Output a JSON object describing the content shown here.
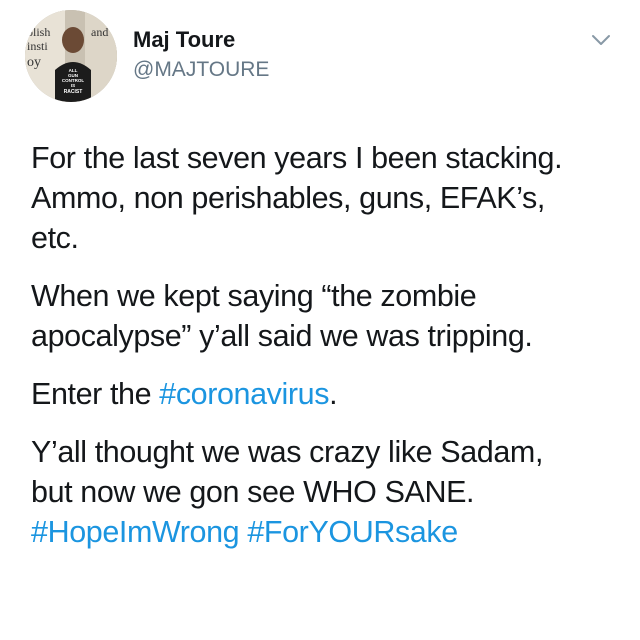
{
  "author": {
    "display_name": "Maj Toure",
    "handle": "@MAJTOURE",
    "avatar_shirt_text": [
      "ALL",
      "GUN",
      "CONTROL",
      "IS",
      "RACIST"
    ],
    "avatar_sign_text": "olish and insti oyc"
  },
  "tweet": {
    "p1": {
      "line1": "For the last seven years I been stacking.",
      "line2": "Ammo, non perishables, guns, EFAK’s,",
      "line3": "etc."
    },
    "p2": {
      "line1": "When we kept saying “the zombie",
      "line2": "apocalypse”  y’all said we was tripping."
    },
    "p3": {
      "prefix": "Enter the ",
      "hashtag": "#coronavirus",
      "suffix": "."
    },
    "p4": {
      "line1": "Y’all thought we was crazy like Sadam,",
      "line2": "but now we gon see WHO SANE.",
      "hashtag1": "#HopeImWrong",
      "hashtag2": "#ForYOURsake"
    }
  },
  "colors": {
    "text": "#14171a",
    "secondary": "#657786",
    "link": "#1b95e0"
  },
  "icons": {
    "menu": "chevron-down-icon"
  }
}
